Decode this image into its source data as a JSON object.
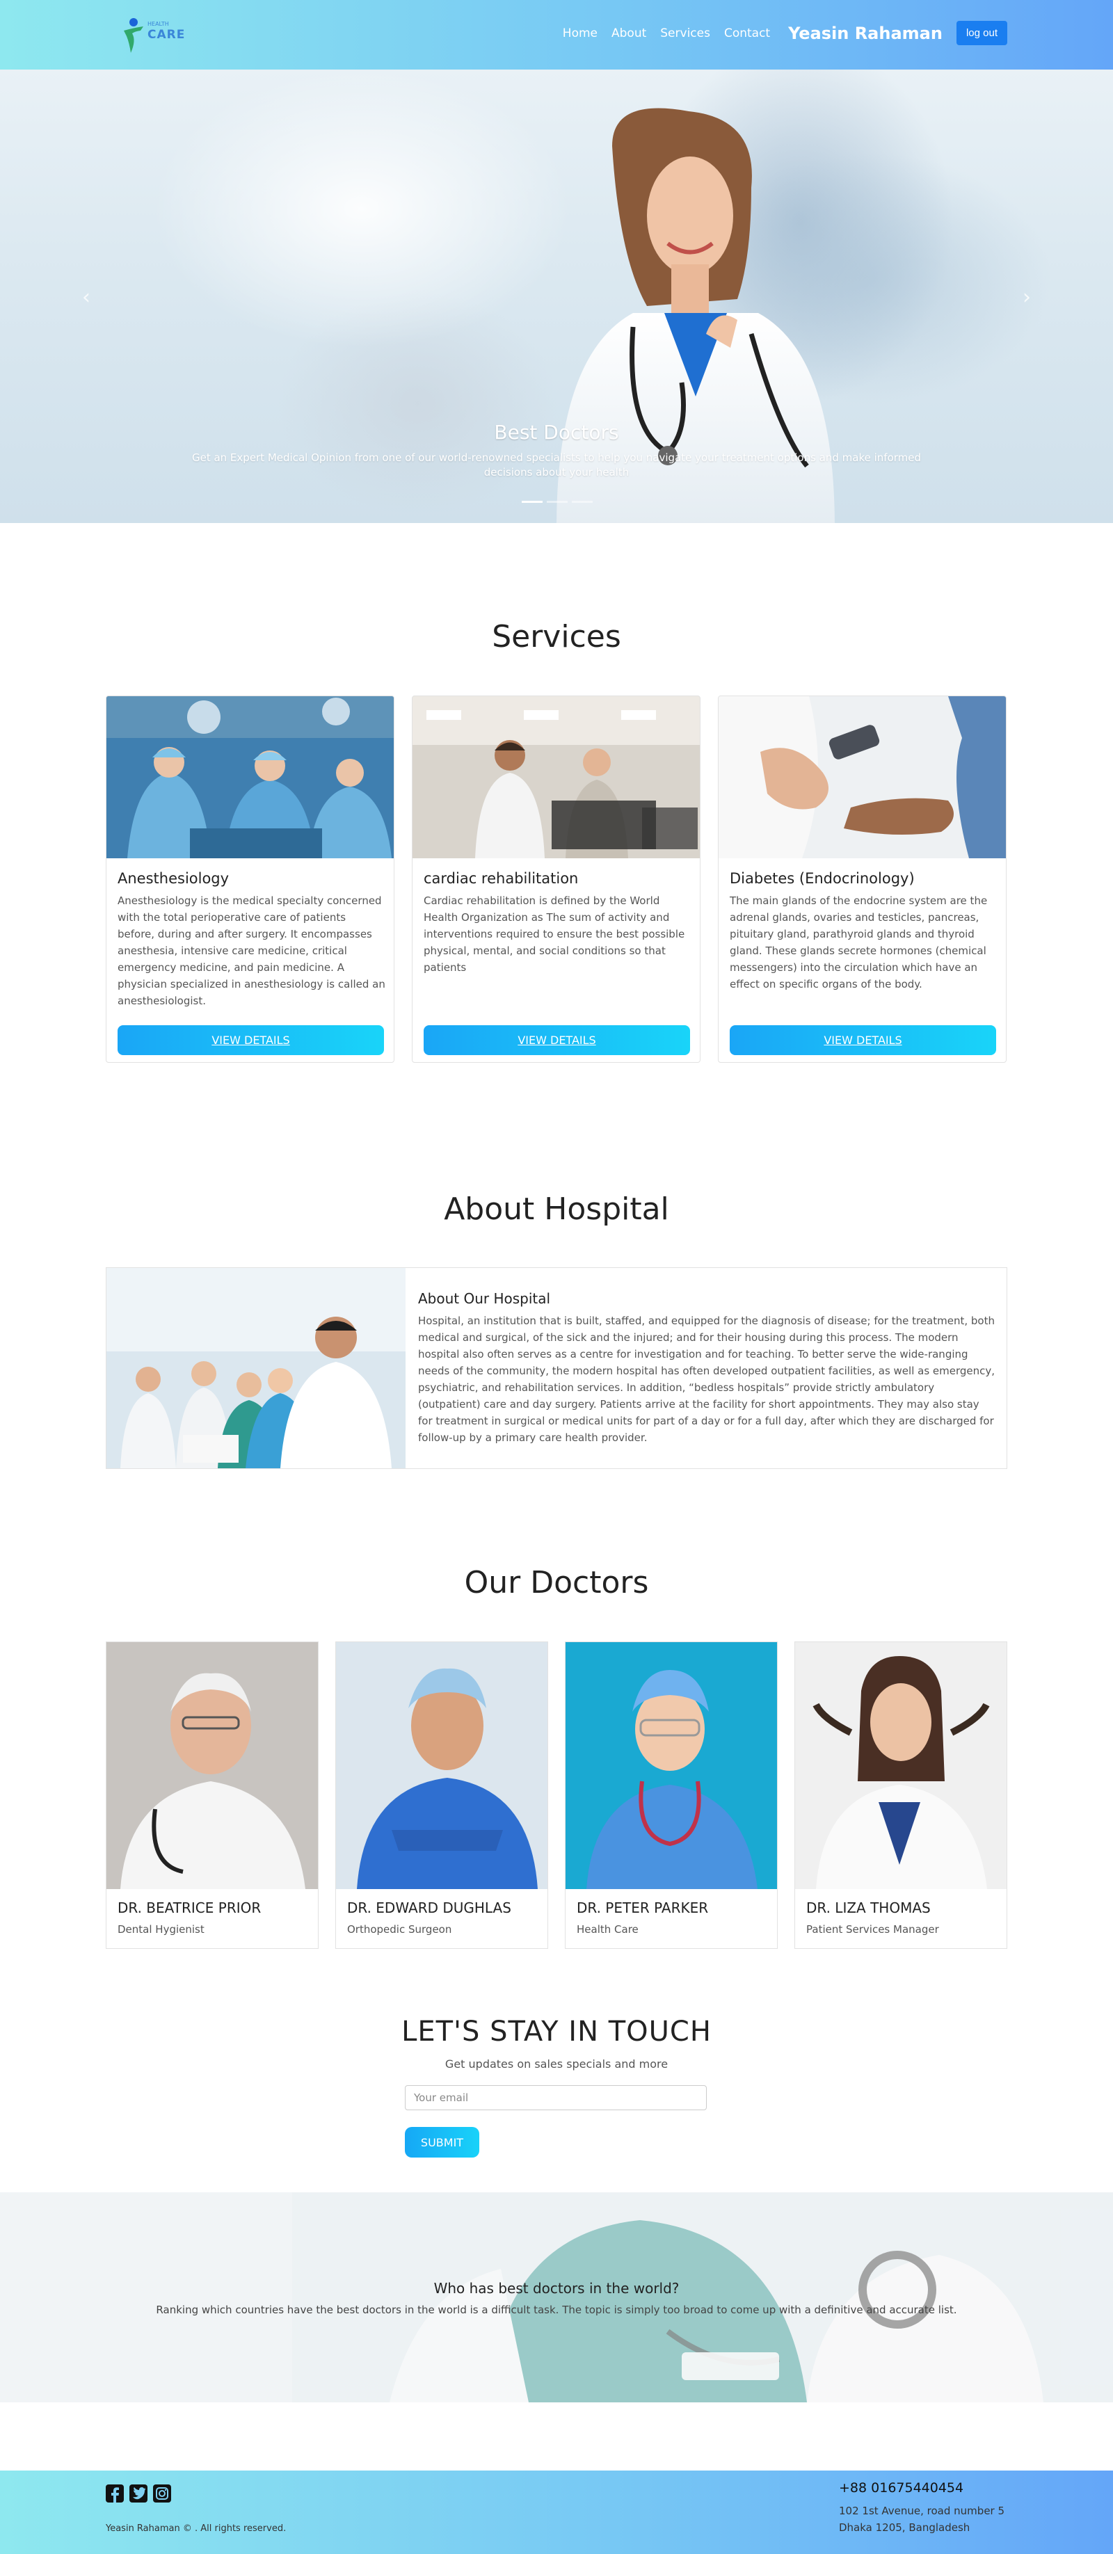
{
  "nav": {
    "logo_text": "CARE",
    "logo_subtext": "HEALTH",
    "links": [
      "Home",
      "About",
      "Services",
      "Contact"
    ],
    "user_name": "Yeasin Rahaman",
    "logout_label": "log out"
  },
  "hero": {
    "title": "Best Doctors",
    "text": "Get an Expert Medical Opinion from one of our world-renowned specialists to help you navigate your treatment options and make informed decisions about your health",
    "prev_icon": "chevron-left-icon",
    "next_icon": "chevron-right-icon"
  },
  "services": {
    "title": "Services",
    "items": [
      {
        "name": "Anesthesiology",
        "description": "Anesthesiology is the medical specialty concerned with the total perioperative care of patients before, during and after surgery. It encompasses anesthesia, intensive care medicine, critical emergency medicine, and pain medicine. A physician specialized in anesthesiology is called an anesthesiologist.",
        "button": "VIEW DETAILS"
      },
      {
        "name": "cardiac rehabilitation",
        "description": "Cardiac rehabilitation is defined by the World Health Organization as The sum of activity and interventions required to ensure the best possible physical, mental, and social conditions so that patients",
        "button": "VIEW DETAILS"
      },
      {
        "name": "Diabetes (Endocrinology)",
        "description": "The main glands of the endocrine system are the adrenal glands, ovaries and testicles, pancreas, pituitary gland, parathyroid glands and thyroid gland. These glands secrete hormones (chemical messengers) into the circulation which have an effect on specific organs of the body.",
        "button": "VIEW DETAILS"
      }
    ]
  },
  "about": {
    "title": "About Hospital",
    "heading": "About Our Hospital",
    "text": "Hospital, an institution that is built, staffed, and equipped for the diagnosis of disease; for the treatment, both medical and surgical, of the sick and the injured; and for their housing during this process. The modern hospital also often serves as a centre for investigation and for teaching. To better serve the wide-ranging needs of the community, the modern hospital has often developed outpatient facilities, as well as emergency, psychiatric, and rehabilitation services. In addition, “bedless hospitals” provide strictly ambulatory (outpatient) care and day surgery. Patients arrive at the facility for short appointments. They may also stay for treatment in surgical or medical units for part of a day or for a full day, after which they are discharged for follow-up by a primary care health provider."
  },
  "doctors": {
    "title": "Our Doctors",
    "items": [
      {
        "name": "DR. BEATRICE PRIOR",
        "role": "Dental Hygienist"
      },
      {
        "name": "DR. EDWARD DUGHLAS",
        "role": "Orthopedic Surgeon"
      },
      {
        "name": "DR. PETER PARKER",
        "role": "Health Care"
      },
      {
        "name": "DR. LIZA THOMAS",
        "role": "Patient Services Manager"
      }
    ]
  },
  "newsletter": {
    "title": "LET'S STAY IN TOUCH",
    "subtitle": "Get updates on sales specials and more",
    "email_placeholder": "Your email",
    "submit_label": "SUBMIT"
  },
  "banner": {
    "title": "Who has best doctors in the world?",
    "text": "Ranking which countries have the best doctors in the world is a difficult task. The topic is simply too broad to come up with a definitive and accurate list."
  },
  "footer": {
    "social_icons": [
      "facebook-icon",
      "twitter-icon",
      "instagram-icon"
    ],
    "copyright": "Yeasin Rahaman © . All rights reserved.",
    "phone": "+88 01675440454",
    "address_line1": "102 1st Avenue, road number 5",
    "address_line2": "Dhaka 1205, Bangladesh"
  },
  "colors": {
    "nav_gradient_start": "#8ee8ef",
    "nav_gradient_end": "#64a6f8",
    "button_gradient_start": "#1aa6f6",
    "button_gradient_end": "#19d4f9",
    "logout_button": "#1a7ef0"
  }
}
